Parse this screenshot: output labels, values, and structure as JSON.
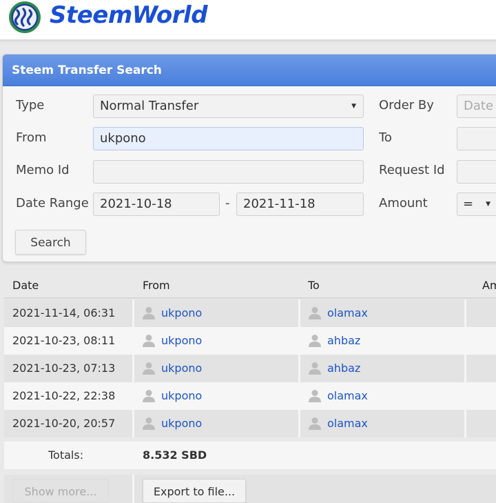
{
  "header": {
    "brand": "SteemWorld",
    "logo_icon": "steem-logo-icon"
  },
  "panel": {
    "title": "Steem Transfer Search",
    "type_label": "Type",
    "type_value": "Normal Transfer",
    "from_label": "From",
    "from_value": "ukpono",
    "memo_label": "Memo Id",
    "memo_value": "",
    "date_range_label": "Date Range",
    "date_from": "2021-10-18",
    "date_separator": "-",
    "date_to": "2021-11-18",
    "order_by_label": "Order By",
    "order_by_value": "Date",
    "to_label": "To",
    "to_value": "",
    "request_id_label": "Request Id",
    "request_id_value": "",
    "amount_label": "Amount",
    "amount_op": "=",
    "search_button": "Search"
  },
  "table": {
    "columns": [
      "Date",
      "From",
      "To",
      "Am"
    ],
    "rows": [
      {
        "date": "2021-11-14, 06:31",
        "from": "ukpono",
        "to": "olamax"
      },
      {
        "date": "2021-10-23, 08:11",
        "from": "ukpono",
        "to": "ahbaz"
      },
      {
        "date": "2021-10-23, 07:13",
        "from": "ukpono",
        "to": "ahbaz"
      },
      {
        "date": "2021-10-22, 22:38",
        "from": "ukpono",
        "to": "olamax"
      },
      {
        "date": "2021-10-20, 20:57",
        "from": "ukpono",
        "to": "olamax"
      }
    ],
    "totals_label": "Totals:",
    "totals_value": "8.532 SBD",
    "show_more": "Show more...",
    "export": "Export to file..."
  },
  "colors": {
    "accent": "#4a7fdc",
    "link": "#1b55c9",
    "brand": "#1a4fd6"
  }
}
